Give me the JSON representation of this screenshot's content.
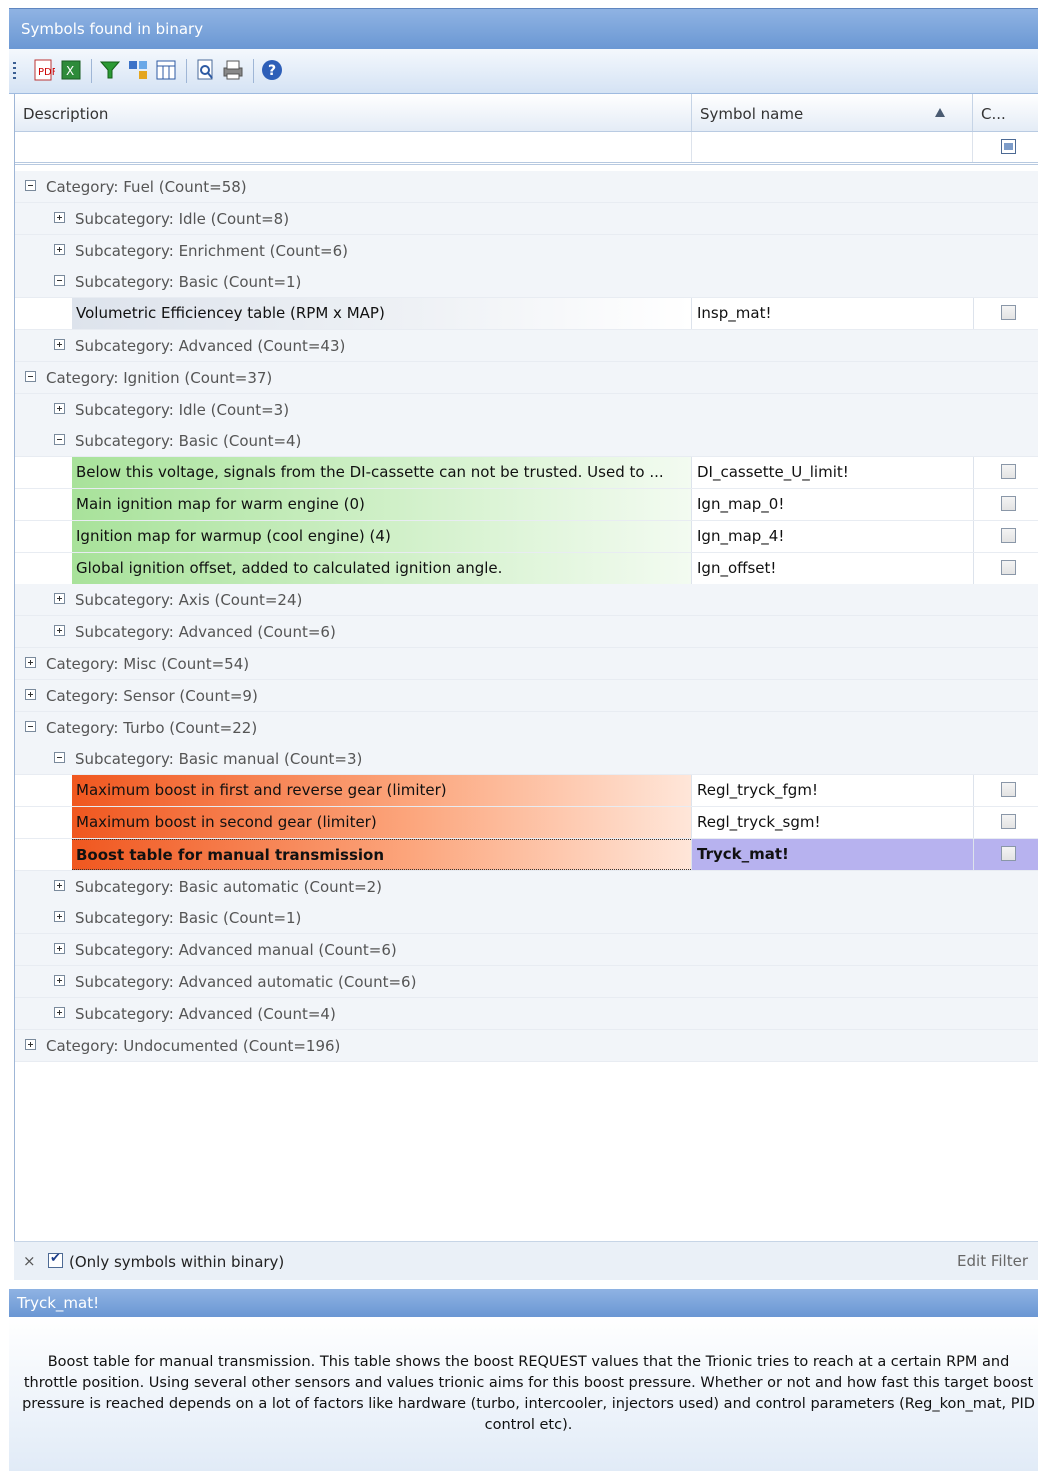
{
  "window": {
    "title": "Symbols found in binary"
  },
  "toolbar": {
    "icons": [
      "export-pdf-icon",
      "export-excel-icon",
      "filter-icon",
      "group-icon",
      "columns-icon",
      "preview-icon",
      "print-icon",
      "help-icon"
    ]
  },
  "columns": {
    "description": "Description",
    "symbol_name": "Symbol name",
    "c": "C..."
  },
  "rows": [
    {
      "type": "group",
      "level": 0,
      "expanded": true,
      "label": "Category: Fuel (Count=58)"
    },
    {
      "type": "group",
      "level": 1,
      "expanded": false,
      "label": "Subcategory: Idle (Count=8)"
    },
    {
      "type": "group",
      "level": 1,
      "expanded": false,
      "label": "Subcategory: Enrichment (Count=6)"
    },
    {
      "type": "group",
      "level": 1,
      "expanded": true,
      "label": "Subcategory: Basic (Count=1)"
    },
    {
      "type": "data",
      "style": "gray",
      "description": "Volumetric Efficiencey table (RPM x MAP)",
      "symbol": "Insp_mat!"
    },
    {
      "type": "group",
      "level": 1,
      "expanded": false,
      "label": "Subcategory: Advanced (Count=43)"
    },
    {
      "type": "group",
      "level": 0,
      "expanded": true,
      "label": "Category: Ignition (Count=37)"
    },
    {
      "type": "group",
      "level": 1,
      "expanded": false,
      "label": "Subcategory: Idle (Count=3)"
    },
    {
      "type": "group",
      "level": 1,
      "expanded": true,
      "label": "Subcategory: Basic (Count=4)"
    },
    {
      "type": "data",
      "style": "green",
      "description": "Below this voltage, signals from the DI-cassette can not be trusted. Used to ...",
      "symbol": "DI_cassette_U_limit!"
    },
    {
      "type": "data",
      "style": "green",
      "description": "Main ignition map for warm engine (0)",
      "symbol": "Ign_map_0!"
    },
    {
      "type": "data",
      "style": "green",
      "description": "Ignition map for warmup (cool engine) (4)",
      "symbol": "Ign_map_4!"
    },
    {
      "type": "data",
      "style": "green",
      "description": "Global ignition offset, added to calculated ignition angle.",
      "symbol": "Ign_offset!"
    },
    {
      "type": "group",
      "level": 1,
      "expanded": false,
      "label": "Subcategory: Axis (Count=24)"
    },
    {
      "type": "group",
      "level": 1,
      "expanded": false,
      "label": "Subcategory: Advanced (Count=6)"
    },
    {
      "type": "group",
      "level": 0,
      "expanded": false,
      "label": "Category: Misc (Count=54)"
    },
    {
      "type": "group",
      "level": 0,
      "expanded": false,
      "label": "Category: Sensor (Count=9)"
    },
    {
      "type": "group",
      "level": 0,
      "expanded": true,
      "label": "Category: Turbo (Count=22)"
    },
    {
      "type": "group",
      "level": 1,
      "expanded": true,
      "label": "Subcategory: Basic manual (Count=3)"
    },
    {
      "type": "data",
      "style": "orange",
      "description": "Maximum boost in first and reverse gear (limiter)",
      "symbol": "Regl_tryck_fgm!"
    },
    {
      "type": "data",
      "style": "orange",
      "description": "Maximum boost in second gear (limiter)",
      "symbol": "Regl_tryck_sgm!"
    },
    {
      "type": "data",
      "style": "selected",
      "description": "Boost table for manual transmission",
      "symbol": "Tryck_mat!"
    },
    {
      "type": "group",
      "level": 1,
      "expanded": false,
      "label": "Subcategory: Basic automatic (Count=2)"
    },
    {
      "type": "group",
      "level": 1,
      "expanded": false,
      "label": "Subcategory: Basic (Count=1)"
    },
    {
      "type": "group",
      "level": 1,
      "expanded": false,
      "label": "Subcategory: Advanced manual (Count=6)"
    },
    {
      "type": "group",
      "level": 1,
      "expanded": false,
      "label": "Subcategory: Advanced automatic (Count=6)"
    },
    {
      "type": "group",
      "level": 1,
      "expanded": false,
      "label": "Subcategory: Advanced (Count=4)"
    },
    {
      "type": "group",
      "level": 0,
      "expanded": false,
      "label": "Category: Undocumented (Count=196)"
    }
  ],
  "footer": {
    "close": "×",
    "filter_text": "(Only symbols within binary)",
    "edit_filter": "Edit Filter"
  },
  "description_panel": {
    "title": "Tryck_mat!",
    "text": "Boost table for manual transmission. This table shows the boost REQUEST values that the Trionic tries to reach at a certain RPM and throttle position. Using several other sensors and values trionic aims for this boost pressure. Whether or not and how fast this target boost pressure is reached depends on a lot of factors like hardware (turbo, intercooler, injectors used) and control parameters (Reg_kon_mat, PID control etc)."
  }
}
